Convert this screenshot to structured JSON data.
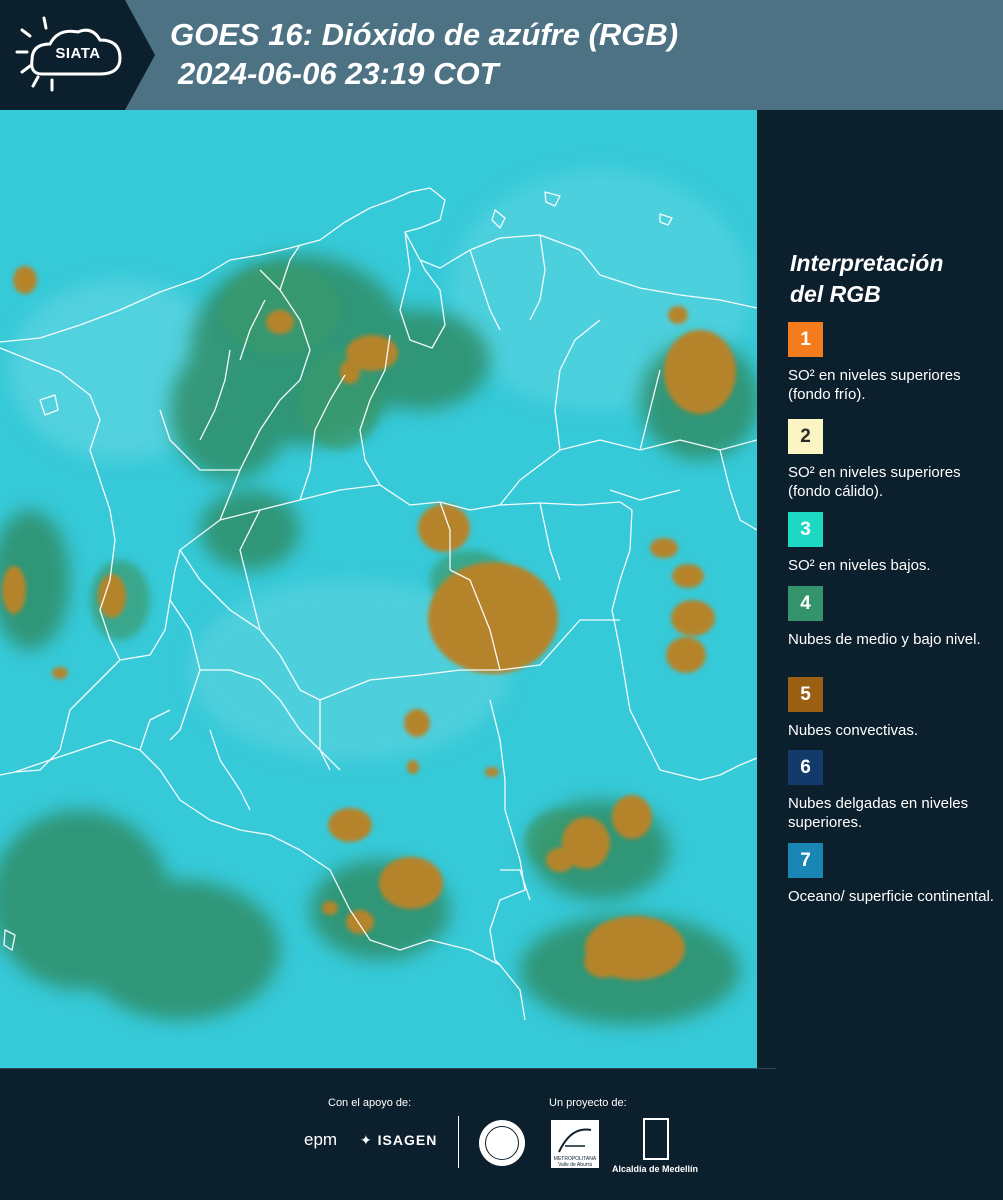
{
  "header": {
    "logo_text": "SIATA",
    "title": "GOES 16: Dióxido de azúfre (RGB)",
    "timestamp": "2024-06-06 23:19 COT"
  },
  "legend": {
    "title_line1": "Interpretación",
    "title_line2": "del RGB",
    "items": [
      {
        "number": "1",
        "color": "#f47c1c",
        "text": "SO² en niveles superiores (fondo frío)."
      },
      {
        "number": "2",
        "color": "#fbf5c4",
        "text": "SO² en niveles superiores (fondo cálido)."
      },
      {
        "number": "3",
        "color": "#1dd8c2",
        "text": "SO² en niveles bajos."
      },
      {
        "number": "4",
        "color": "#33946c",
        "text": "Nubes de medio y bajo nivel."
      },
      {
        "number": "5",
        "color": "#9a5f12",
        "text": "Nubes convectivas."
      },
      {
        "number": "6",
        "color": "#123a6a",
        "text": "Nubes delgadas en niveles superiores."
      },
      {
        "number": "7",
        "color": "#1a86b4",
        "text": "Oceano/ superficie continental."
      }
    ]
  },
  "footer": {
    "support_label": "Con el apoyo de:",
    "project_label": "Un proyecto de:",
    "brand_epm": "epm",
    "brand_isagen": "ISAGEN",
    "area_logo_text": "METROPOLITANA Valle de Aburrá",
    "alcaldia_text": "Alcaldía de Medellín"
  },
  "colors": {
    "header_bg": "#4d7283",
    "panel_bg": "#0c1f2c",
    "map_cyan": "#36c9d8",
    "map_green": "#2f8a60",
    "map_convective": "#b5842c",
    "borders": "#ffffff"
  }
}
